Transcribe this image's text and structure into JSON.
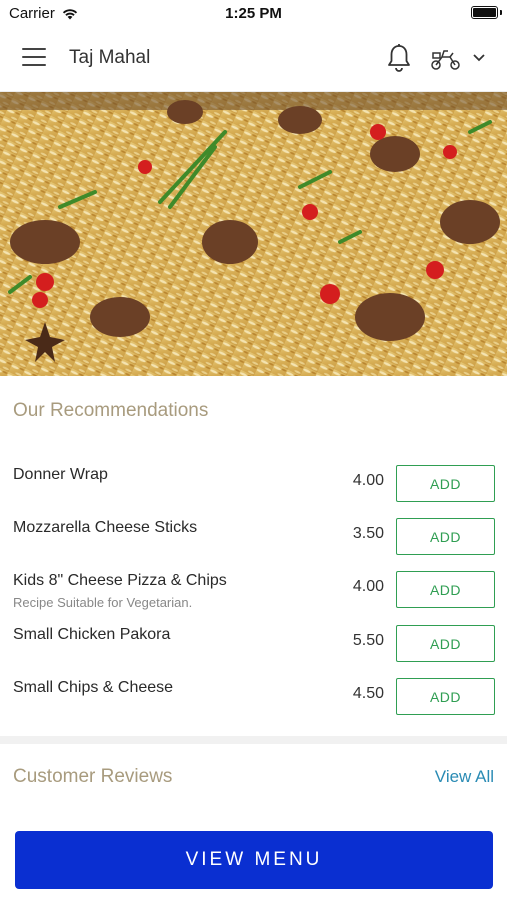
{
  "status_bar": {
    "carrier": "Carrier",
    "time": "1:25 PM",
    "battery_level": 1.0
  },
  "header": {
    "title": "Taj Mahal",
    "icons": [
      "menu-icon",
      "bell-icon",
      "scooter-icon",
      "chevron-down-icon"
    ]
  },
  "hero": {
    "icon": "biryani-photo"
  },
  "recommendations": {
    "title": "Our Recommendations",
    "items": [
      {
        "name": "Donner Wrap",
        "note": "",
        "price": "4.00",
        "button": "ADD"
      },
      {
        "name": "Mozzarella Cheese Sticks",
        "note": "",
        "price": "3.50",
        "button": "ADD"
      },
      {
        "name": "Kids 8\" Cheese Pizza & Chips",
        "note": "Recipe Suitable for Vegetarian.",
        "price": "4.00",
        "button": "ADD"
      },
      {
        "name": "Small Chicken Pakora",
        "note": "",
        "price": "5.50",
        "button": "ADD"
      },
      {
        "name": "Small Chips & Cheese",
        "note": "",
        "price": "4.50",
        "button": "ADD"
      }
    ]
  },
  "reviews": {
    "title": "Customer Reviews",
    "view_all": "View All"
  },
  "cta": {
    "label": "VIEW MENU"
  },
  "colors": {
    "accent_green": "#2f9e52",
    "primary_blue": "#0a2fd1",
    "link_blue": "#2a8bb4",
    "section_title": "#a89b7e"
  }
}
